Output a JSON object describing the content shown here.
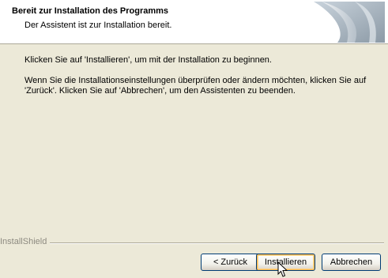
{
  "header": {
    "title": "Bereit zur Installation des Programms",
    "subtitle": "Der Assistent ist zur Installation bereit."
  },
  "body": {
    "paragraph1": "Klicken Sie auf 'Installieren', um mit der Installation zu beginnen.",
    "paragraph2": "Wenn Sie die Installationseinstellungen überprüfen oder ändern möchten, klicken Sie auf 'Zurück'. Klicken Sie auf 'Abbrechen', um den Assistenten zu beenden."
  },
  "footer": {
    "brand": "InstallShield"
  },
  "buttons": {
    "back": "< Zurück",
    "install": "Installieren",
    "cancel": "Abbrechen"
  },
  "icons": {
    "header_graphic": "installer-banner-icon",
    "cursor": "pointer-cursor-icon"
  },
  "colors": {
    "dialog_background": "#ece9d8",
    "header_background": "#ffffff",
    "button_border": "#003c74",
    "default_button_focus": "#f9b852"
  }
}
